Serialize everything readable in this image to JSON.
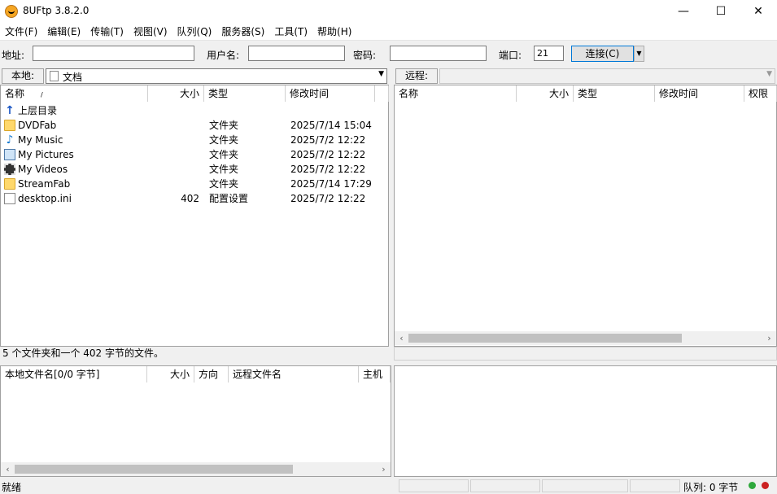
{
  "window": {
    "title": "8UFtp 3.8.2.0",
    "minimize": "—",
    "maximize": "☐",
    "close": "✕"
  },
  "menu": [
    "文件(F)",
    "编辑(E)",
    "传输(T)",
    "视图(V)",
    "队列(Q)",
    "服务器(S)",
    "工具(T)",
    "帮助(H)"
  ],
  "connect": {
    "address_label": "地址:",
    "address_value": "",
    "user_label": "用户名:",
    "user_value": "",
    "password_label": "密码:",
    "password_value": "",
    "port_label": "端口:",
    "port_value": "21",
    "connect_label": "连接(C)"
  },
  "local": {
    "label": "本地:",
    "path": "文档",
    "columns": [
      "名称",
      "大小",
      "类型",
      "修改时间"
    ],
    "files": [
      {
        "name": "上层目录",
        "size": "",
        "type": "",
        "modified": "",
        "icon": "up-folder-icon"
      },
      {
        "name": "DVDFab",
        "size": "",
        "type": "文件夹",
        "modified": "2025/7/14 15:04",
        "icon": "folder-icon"
      },
      {
        "name": "My Music",
        "size": "",
        "type": "文件夹",
        "modified": "2025/7/2 12:22",
        "icon": "music-note-icon"
      },
      {
        "name": "My Pictures",
        "size": "",
        "type": "文件夹",
        "modified": "2025/7/2 12:22",
        "icon": "pictures-icon"
      },
      {
        "name": "My Videos",
        "size": "",
        "type": "文件夹",
        "modified": "2025/7/2 12:22",
        "icon": "film-icon"
      },
      {
        "name": "StreamFab",
        "size": "",
        "type": "文件夹",
        "modified": "2025/7/14 17:29",
        "icon": "folder-icon"
      },
      {
        "name": "desktop.ini",
        "size": "402",
        "type": "配置设置",
        "modified": "2025/7/2 12:22",
        "icon": "settings-file-icon"
      }
    ],
    "status": "5 个文件夹和一个 402 字节的文件。"
  },
  "remote": {
    "label": "远程:",
    "path": "",
    "columns": [
      "名称",
      "大小",
      "类型",
      "修改时间",
      "权限"
    ]
  },
  "queue": {
    "columns": [
      "本地文件名[0/0 字节]",
      "大小",
      "方向",
      "远程文件名",
      "主机"
    ]
  },
  "statusbar": {
    "left": "就绪",
    "queue": "队列: 0 字节"
  }
}
